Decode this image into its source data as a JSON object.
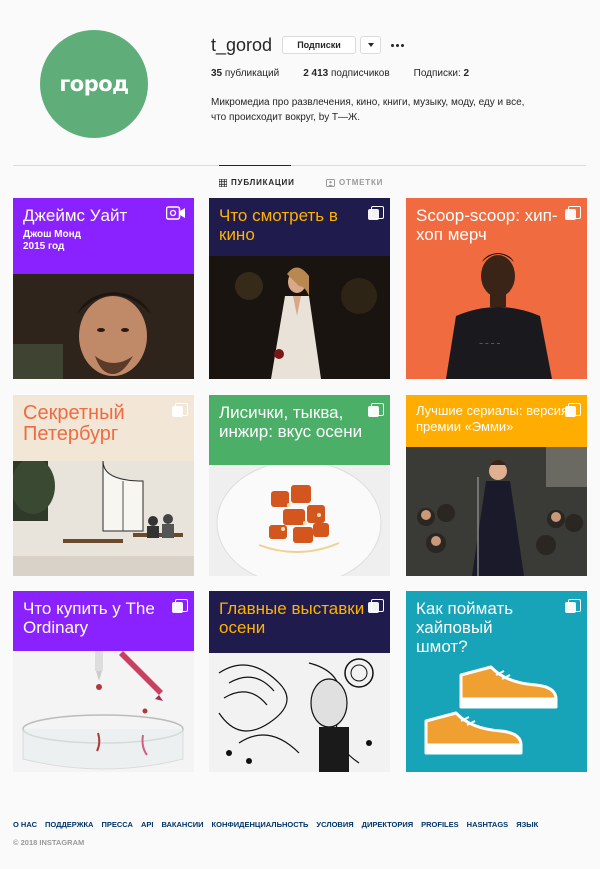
{
  "profile": {
    "avatar_text": "город",
    "username": "t_gorod",
    "follow_label": "Подписки",
    "posts_count": "35",
    "posts_label": "публикаций",
    "followers_count": "2 413",
    "followers_label": "подписчиков",
    "following_label": "Подписки:",
    "following_count": "2",
    "bio": "Микромедиа про развлечения, кино, книги, музыку, моду, еду и все, что происходит вокруг, by T—Ж."
  },
  "tabs": {
    "posts": "ПУБЛИКАЦИИ",
    "tagged": "ОТМЕТКИ"
  },
  "posts": [
    {
      "title": "Джеймс Уайт",
      "subtitle": "Джош Монд 2015 год",
      "band_color": "#8a22ff",
      "text_color": "#ffffff",
      "type": "video",
      "image": "portrait-man"
    },
    {
      "title": "Что смотреть в кино",
      "band_color": "#1f1b4d",
      "text_color": "#ffb200",
      "type": "carousel",
      "image": "actress-dress"
    },
    {
      "title": "Scoop-scoop: хип-хоп мерч",
      "band_color": "#f06b3f",
      "text_color": "#ffffff",
      "type": "carousel",
      "image": "man-tshirt"
    },
    {
      "title": "Секретный Петербург",
      "band_color": "#f2e6d6",
      "text_color": "#f06b3f",
      "type": "carousel",
      "image": "cafe-interior"
    },
    {
      "title": "Лисички, тыква, инжир: вкус осени",
      "band_color": "#4caf68",
      "text_color": "#ffffff",
      "type": "carousel",
      "image": "food-plate"
    },
    {
      "title": "Лучшие сериалы: версия премии «Эмми»",
      "band_color": "#ffad00",
      "text_color": "#ffffff",
      "type": "carousel",
      "image": "stage-singer"
    },
    {
      "title": "Что купить у The Ordinary",
      "band_color": "#8a22ff",
      "text_color": "#ffffff",
      "type": "carousel",
      "image": "dropper-glass"
    },
    {
      "title": "Главные выставки осени",
      "band_color": "#1f1b4d",
      "text_color": "#ffb200",
      "type": "carousel",
      "image": "engraving"
    },
    {
      "title": "Как поймать хайповый шмот?",
      "band_color": "#17a3b8",
      "text_color": "#ffffff",
      "type": "carousel",
      "image": "sneakers"
    }
  ],
  "footer": {
    "links": [
      "О НАС",
      "ПОДДЕРЖКА",
      "ПРЕССА",
      "API",
      "ВАКАНСИИ",
      "КОНФИДЕНЦИАЛЬНОСТЬ",
      "УСЛОВИЯ",
      "ДИРЕКТОРИЯ",
      "PROFILES",
      "HASHTAGS",
      "ЯЗЫК"
    ],
    "copyright": "© 2018 INSTAGRAM"
  },
  "colors": {
    "link": "#003569",
    "border": "#dbdbdb",
    "avatar_bg": "#5fae7a"
  }
}
